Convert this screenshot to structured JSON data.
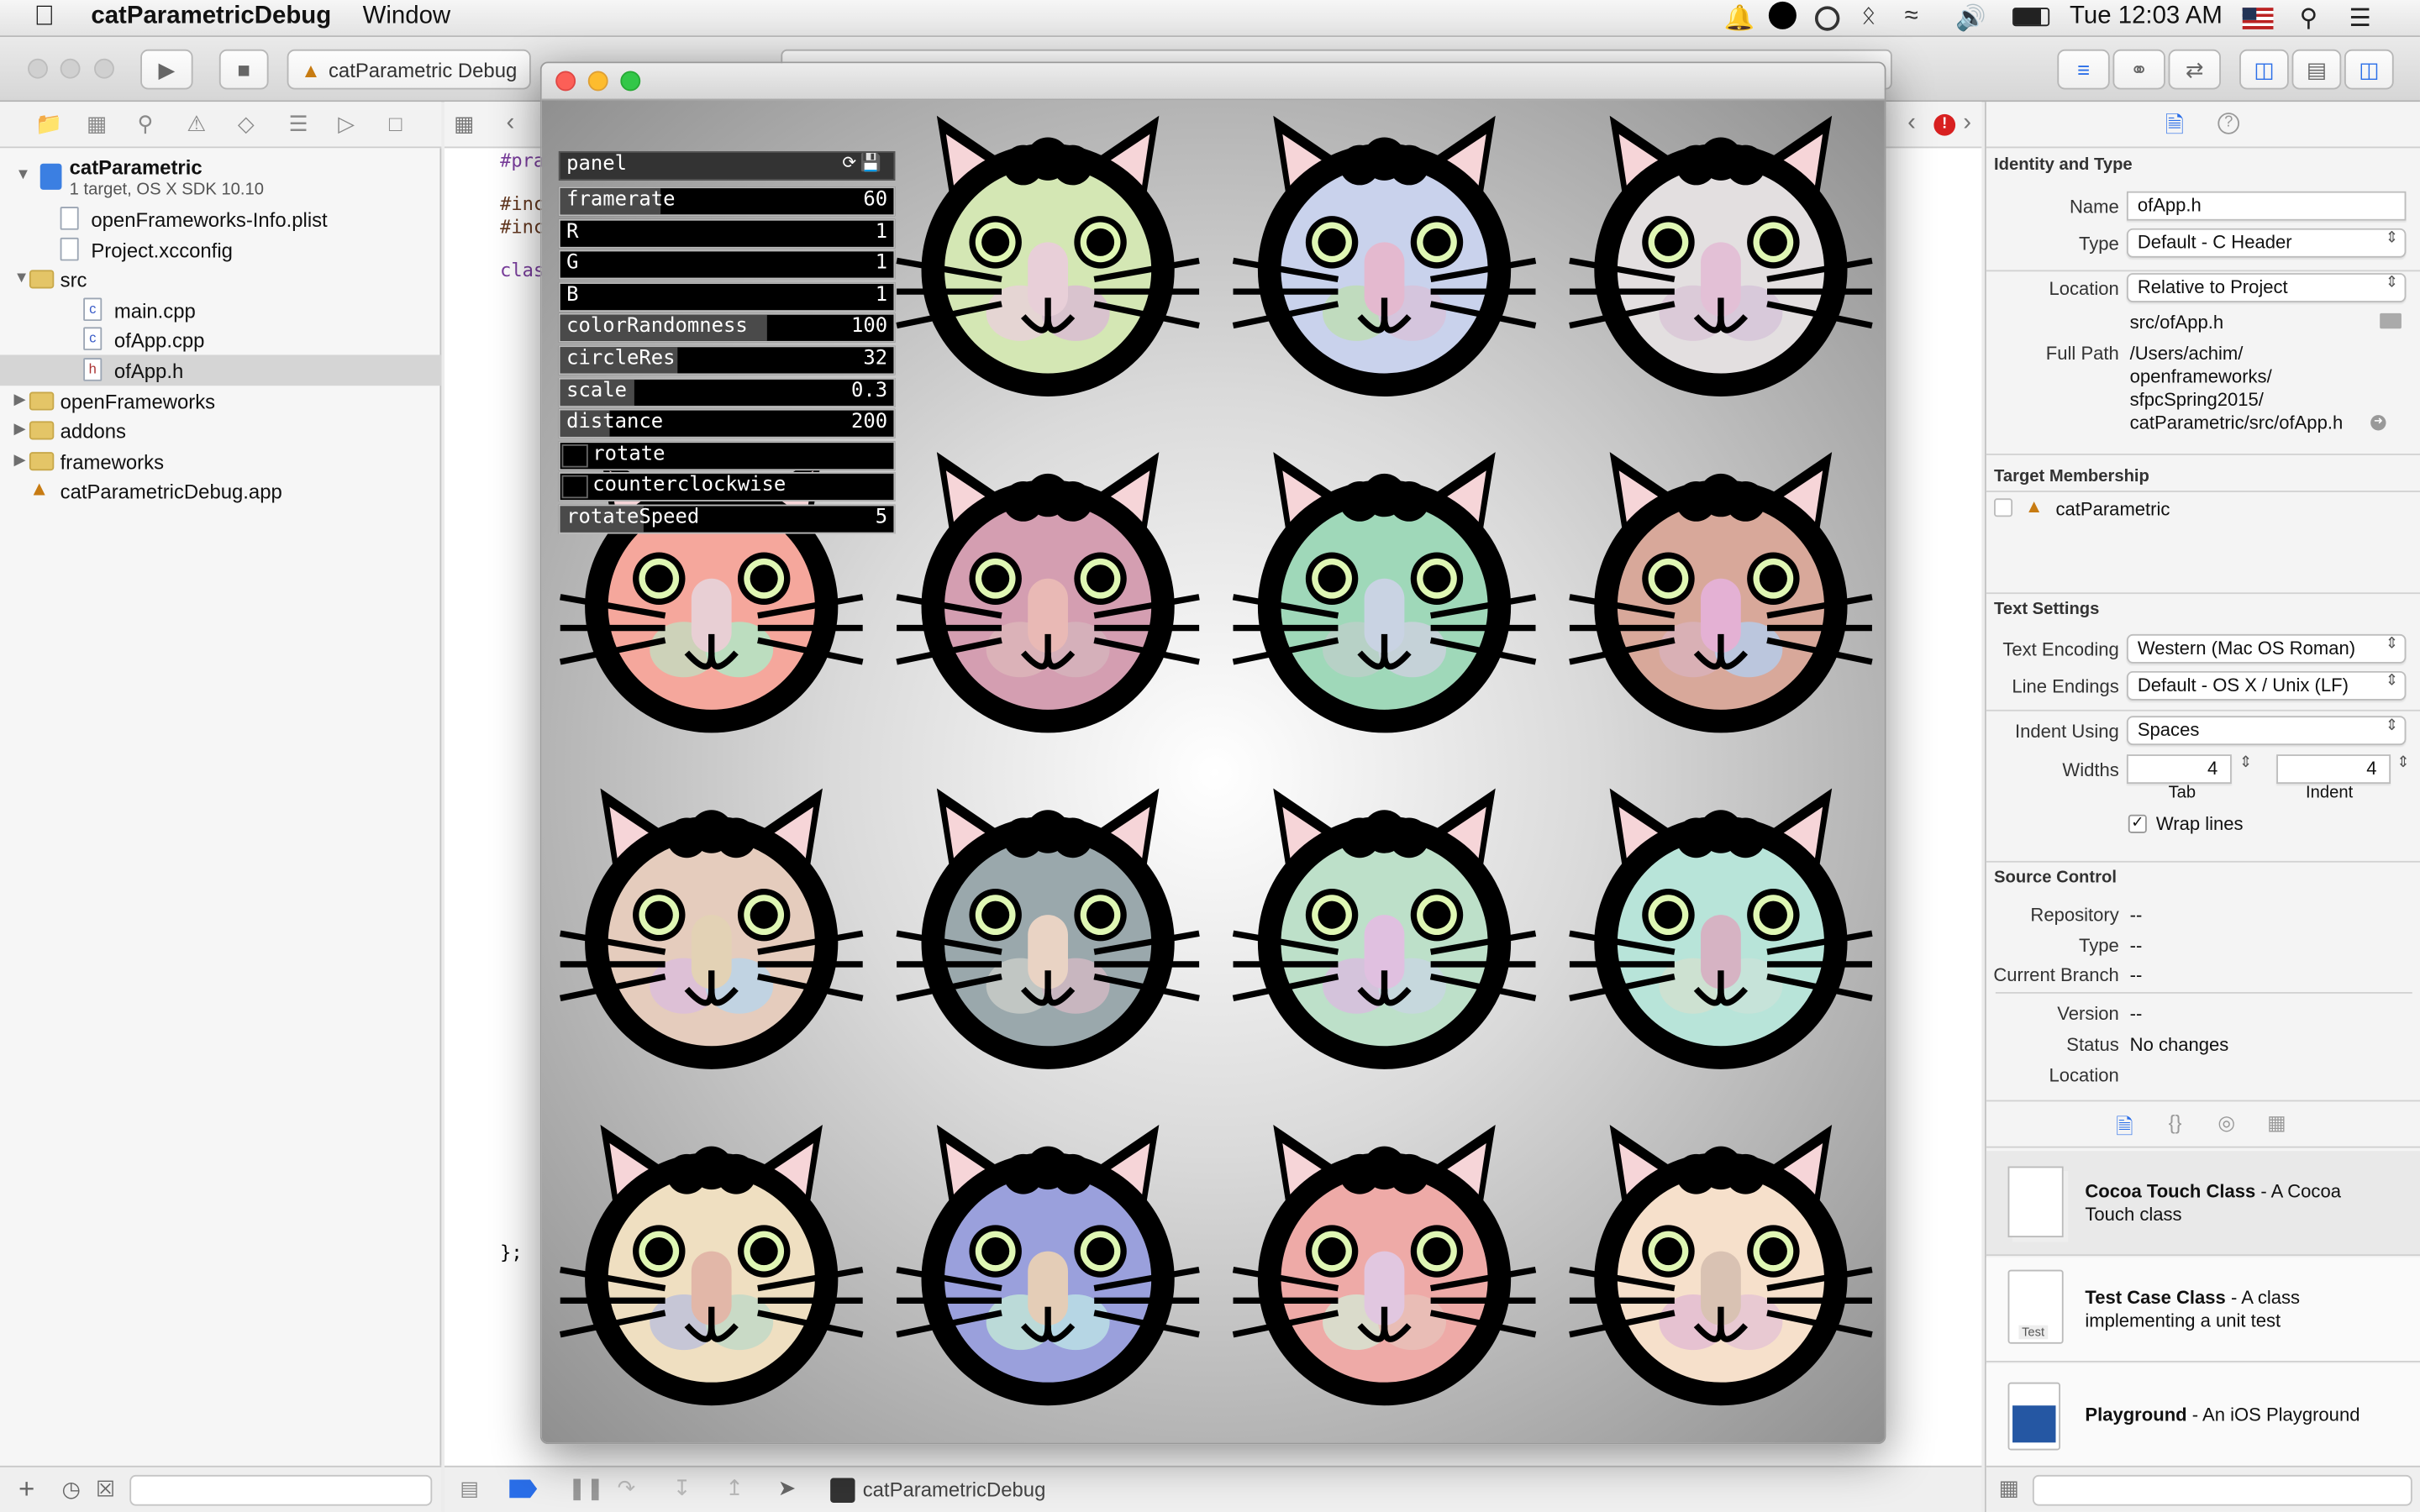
{
  "menubar": {
    "app_name": "catParametricDebug",
    "menu_window": "Window",
    "clock": "Tue 12:03 AM"
  },
  "toolbar": {
    "scheme": "catParametric Debug"
  },
  "navigator": {
    "project": {
      "name": "catParametric",
      "subtitle": "1 target, OS X SDK 10.10"
    },
    "items": [
      {
        "label": "openFrameworks-Info.plist",
        "kind": "file"
      },
      {
        "label": "Project.xcconfig",
        "kind": "file"
      },
      {
        "label": "src",
        "kind": "folder"
      },
      {
        "label": "main.cpp",
        "kind": "file"
      },
      {
        "label": "ofApp.cpp",
        "kind": "file"
      },
      {
        "label": "ofApp.h",
        "kind": "file",
        "selected": true
      },
      {
        "label": "openFrameworks",
        "kind": "folder"
      },
      {
        "label": "addons",
        "kind": "folder"
      },
      {
        "label": "frameworks",
        "kind": "folder"
      },
      {
        "label": "catParametricDebug.app",
        "kind": "app"
      }
    ]
  },
  "editor": {
    "code_lines": [
      "#pra",
      "#inc",
      "#inc",
      "clas",
      "};"
    ]
  },
  "debugbar": {
    "target": "catParametricDebug"
  },
  "inspector": {
    "identity": {
      "title": "Identity and Type",
      "name_label": "Name",
      "name_value": "ofApp.h",
      "type_label": "Type",
      "type_value": "Default - C Header",
      "location_label": "Location",
      "location_value": "Relative to Project",
      "relative_path": "src/ofApp.h",
      "fullpath_label": "Full Path",
      "fullpath_lines": [
        "/Users/achim/",
        "openframeworks/",
        "sfpcSpring2015/",
        "catParametric/src/ofApp.h"
      ]
    },
    "target_membership": {
      "title": "Target Membership",
      "target": "catParametric"
    },
    "text_settings": {
      "title": "Text Settings",
      "encoding_label": "Text Encoding",
      "encoding_value": "Western (Mac OS Roman)",
      "line_endings_label": "Line Endings",
      "line_endings_value": "Default - OS X / Unix (LF)",
      "indent_label": "Indent Using",
      "indent_value": "Spaces",
      "widths_label": "Widths",
      "tab_value": "4",
      "indent_width_value": "4",
      "tab_caption": "Tab",
      "indent_caption": "Indent",
      "wrap_label": "Wrap lines"
    },
    "source_control": {
      "title": "Source Control",
      "repository_label": "Repository",
      "repository_value": "--",
      "type_label": "Type",
      "type_value": "--",
      "branch_label": "Current Branch",
      "branch_value": "--",
      "version_label": "Version",
      "version_value": "--",
      "status_label": "Status",
      "status_value": "No changes",
      "location_label": "Location"
    },
    "library": [
      {
        "name": "Cocoa Touch Class",
        "desc1": " - A Cocoa",
        "desc2": "Touch class",
        "icon": "cocoa-touch-class-icon"
      },
      {
        "name": "Test Case Class",
        "desc1": " - A class",
        "desc2": "implementing a unit test",
        "icon_text": "Test",
        "icon": "test-case-class-icon"
      },
      {
        "name": "Playground",
        "desc1": " - An iOS Playground",
        "desc2": "",
        "icon": "playground-icon"
      }
    ]
  },
  "gui_panel": {
    "title": "panel",
    "params": [
      {
        "label": "framerate",
        "value": "60",
        "fill": 0.3,
        "kind": "slider"
      },
      {
        "label": "R",
        "value": "1",
        "fill": 0.0,
        "kind": "slider"
      },
      {
        "label": "G",
        "value": "1",
        "fill": 0.0,
        "kind": "slider"
      },
      {
        "label": "B",
        "value": "1",
        "fill": 0.0,
        "kind": "slider"
      },
      {
        "label": "colorRandomness",
        "value": "100",
        "fill": 0.62,
        "kind": "slider"
      },
      {
        "label": "circleRes",
        "value": "32",
        "fill": 0.35,
        "kind": "slider"
      },
      {
        "label": "scale",
        "value": "0.3",
        "fill": 0.22,
        "kind": "slider"
      },
      {
        "label": "distance",
        "value": "200",
        "fill": 0.15,
        "kind": "slider"
      },
      {
        "label": "rotate",
        "value": "",
        "fill": 0,
        "kind": "toggle"
      },
      {
        "label": "counterclockwise",
        "value": "",
        "fill": 0,
        "kind": "toggle"
      },
      {
        "label": "rotateSpeed",
        "value": "5",
        "fill": 0.25,
        "kind": "slider"
      }
    ]
  },
  "cats": [
    {
      "face": "#d4e7b4",
      "nose": "#e8cfd8",
      "c1": "#e7d3d6",
      "c2": "#d9bfd0"
    },
    {
      "face": "#c9d2ec",
      "nose": "#e4b9cf",
      "c1": "#bfdcb9",
      "c2": "#d6c3dc"
    },
    {
      "face": "#e3dfe0",
      "nose": "#e3c0d6",
      "c1": "#d9c8d7",
      "c2": "#d6c7d9"
    },
    {
      "face": "#f5a79c",
      "nose": "#e8cfd4",
      "c1": "#c9d7bd",
      "c2": "#b6e3c3"
    },
    {
      "face": "#d49eb1",
      "nose": "#e9b9b5",
      "c1": "#dcb4b9",
      "c2": "#d5b1bb"
    },
    {
      "face": "#9fd8b9",
      "nose": "#c9d3e3",
      "c1": "#b9d0c8",
      "c2": "#c9d1dc"
    },
    {
      "face": "#d8a89a",
      "nose": "#e4b1d4",
      "c1": "#d9b0b8",
      "c2": "#b8c9e4"
    },
    {
      "face": "#e5ccbd",
      "nose": "#e3d2b5",
      "c1": "#dbbfd8",
      "c2": "#bcd4e5"
    },
    {
      "face": "#9aa8ac",
      "nose": "#e9d3c4",
      "c1": "#c5c9c5",
      "c2": "#cdb7c1"
    },
    {
      "face": "#bde0c9",
      "nose": "#e0c0e0",
      "c1": "#d6c0dd",
      "c2": "#c6d7df"
    },
    {
      "face": "#b8e4d9",
      "nose": "#d6b3c3",
      "c1": "#cfe0cf",
      "c2": "#c8e2d8"
    },
    {
      "face": "#efdfc1",
      "nose": "#e2b7a8",
      "c1": "#c1c3d8",
      "c2": "#c4d9c7"
    },
    {
      "face": "#9aa0dc",
      "nose": "#e4cdb7",
      "c1": "#bfe0d7",
      "c2": "#b9dce4"
    },
    {
      "face": "#eeaaa7",
      "nose": "#e1c7e0",
      "c1": "#d7e0cf",
      "c2": "#e8bfb8"
    },
    {
      "face": "#f6e0cb",
      "nose": "#d9c2b3",
      "c1": "#e4bfd2",
      "c2": "#e7c7d3"
    }
  ]
}
